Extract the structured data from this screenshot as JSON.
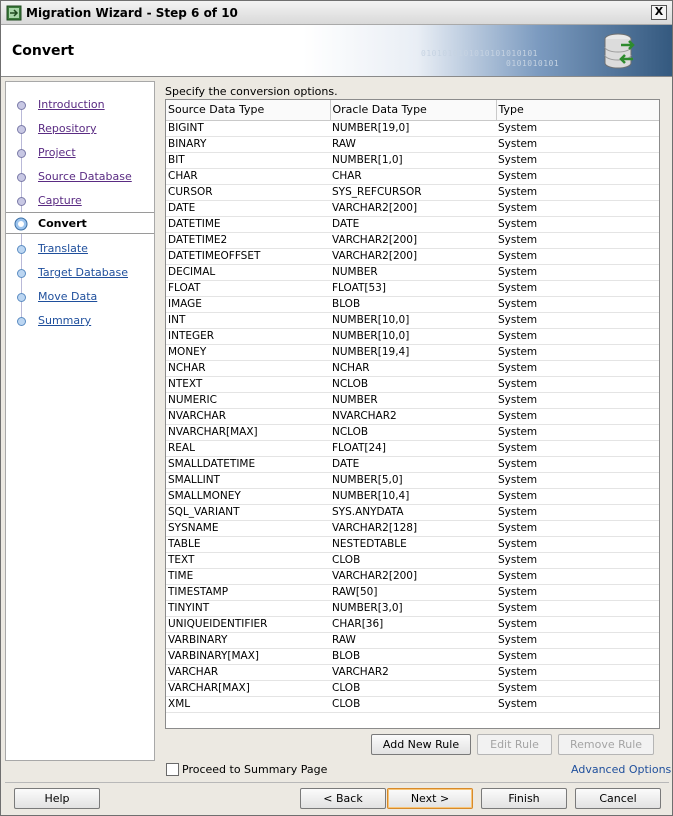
{
  "window": {
    "title": "Migration Wizard - Step 6 of 10",
    "close_label": "X"
  },
  "banner": {
    "title": "Convert",
    "deco_text_1": "0101010101010101010101",
    "deco_text_2": "0101010101"
  },
  "nav": {
    "items": [
      {
        "label": "Introduction"
      },
      {
        "label": "Repository"
      },
      {
        "label": "Project"
      },
      {
        "label": "Source Database"
      },
      {
        "label": "Capture "
      },
      {
        "label": "Convert",
        "current": true
      },
      {
        "label": "Translate"
      },
      {
        "label": "Target Database"
      },
      {
        "label": "Move Data"
      },
      {
        "label": "Summary"
      }
    ]
  },
  "main": {
    "instructions": "Specify the conversion options.",
    "columns": [
      "Source Data Type",
      "Oracle Data Type",
      "Type"
    ],
    "rows": [
      [
        "BIGINT",
        "NUMBER[19,0]",
        "System"
      ],
      [
        "BINARY",
        "RAW",
        "System"
      ],
      [
        "BIT",
        "NUMBER[1,0]",
        "System"
      ],
      [
        "CHAR",
        "CHAR",
        "System"
      ],
      [
        "CURSOR",
        "SYS_REFCURSOR",
        "System"
      ],
      [
        "DATE",
        "VARCHAR2[200]",
        "System"
      ],
      [
        "DATETIME",
        "DATE",
        "System"
      ],
      [
        "DATETIME2",
        "VARCHAR2[200]",
        "System"
      ],
      [
        "DATETIMEOFFSET",
        "VARCHAR2[200]",
        "System"
      ],
      [
        "DECIMAL",
        "NUMBER",
        "System"
      ],
      [
        "FLOAT",
        "FLOAT[53]",
        "System"
      ],
      [
        "IMAGE",
        "BLOB",
        "System"
      ],
      [
        "INT",
        "NUMBER[10,0]",
        "System"
      ],
      [
        "INTEGER",
        "NUMBER[10,0]",
        "System"
      ],
      [
        "MONEY",
        "NUMBER[19,4]",
        "System"
      ],
      [
        "NCHAR",
        "NCHAR",
        "System"
      ],
      [
        "NTEXT",
        "NCLOB",
        "System"
      ],
      [
        "NUMERIC",
        "NUMBER",
        "System"
      ],
      [
        "NVARCHAR",
        "NVARCHAR2",
        "System"
      ],
      [
        "NVARCHAR[MAX]",
        "NCLOB",
        "System"
      ],
      [
        "REAL",
        "FLOAT[24]",
        "System"
      ],
      [
        "SMALLDATETIME",
        "DATE",
        "System"
      ],
      [
        "SMALLINT",
        "NUMBER[5,0]",
        "System"
      ],
      [
        "SMALLMONEY",
        "NUMBER[10,4]",
        "System"
      ],
      [
        "SQL_VARIANT",
        "SYS.ANYDATA",
        "System"
      ],
      [
        "SYSNAME",
        "VARCHAR2[128]",
        "System"
      ],
      [
        "TABLE",
        "NESTEDTABLE",
        "System"
      ],
      [
        "TEXT",
        "CLOB",
        "System"
      ],
      [
        "TIME",
        "VARCHAR2[200]",
        "System"
      ],
      [
        "TIMESTAMP",
        "RAW[50]",
        "System"
      ],
      [
        "TINYINT",
        "NUMBER[3,0]",
        "System"
      ],
      [
        "UNIQUEIDENTIFIER",
        "CHAR[36]",
        "System"
      ],
      [
        "VARBINARY",
        "RAW",
        "System"
      ],
      [
        "VARBINARY[MAX]",
        "BLOB",
        "System"
      ],
      [
        "VARCHAR",
        "VARCHAR2",
        "System"
      ],
      [
        "VARCHAR[MAX]",
        "CLOB",
        "System"
      ],
      [
        "XML",
        "CLOB",
        "System"
      ]
    ],
    "add_rule_label": "Add New Rule",
    "edit_rule_label": "Edit Rule",
    "remove_rule_label": "Remove Rule",
    "proceed_label": "Proceed to Summary Page",
    "proceed_checked": false,
    "advanced_options_label": "Advanced Options"
  },
  "footer": {
    "help_label": "Help",
    "back_label": "< Back",
    "next_label": "Next >",
    "finish_label": "Finish",
    "cancel_label": "Cancel"
  },
  "colors": {
    "nav_link": "#5a2b83",
    "link": "#1f4f9c",
    "default_button_border": "#d88a2a",
    "banner_dark": "#34597f"
  }
}
